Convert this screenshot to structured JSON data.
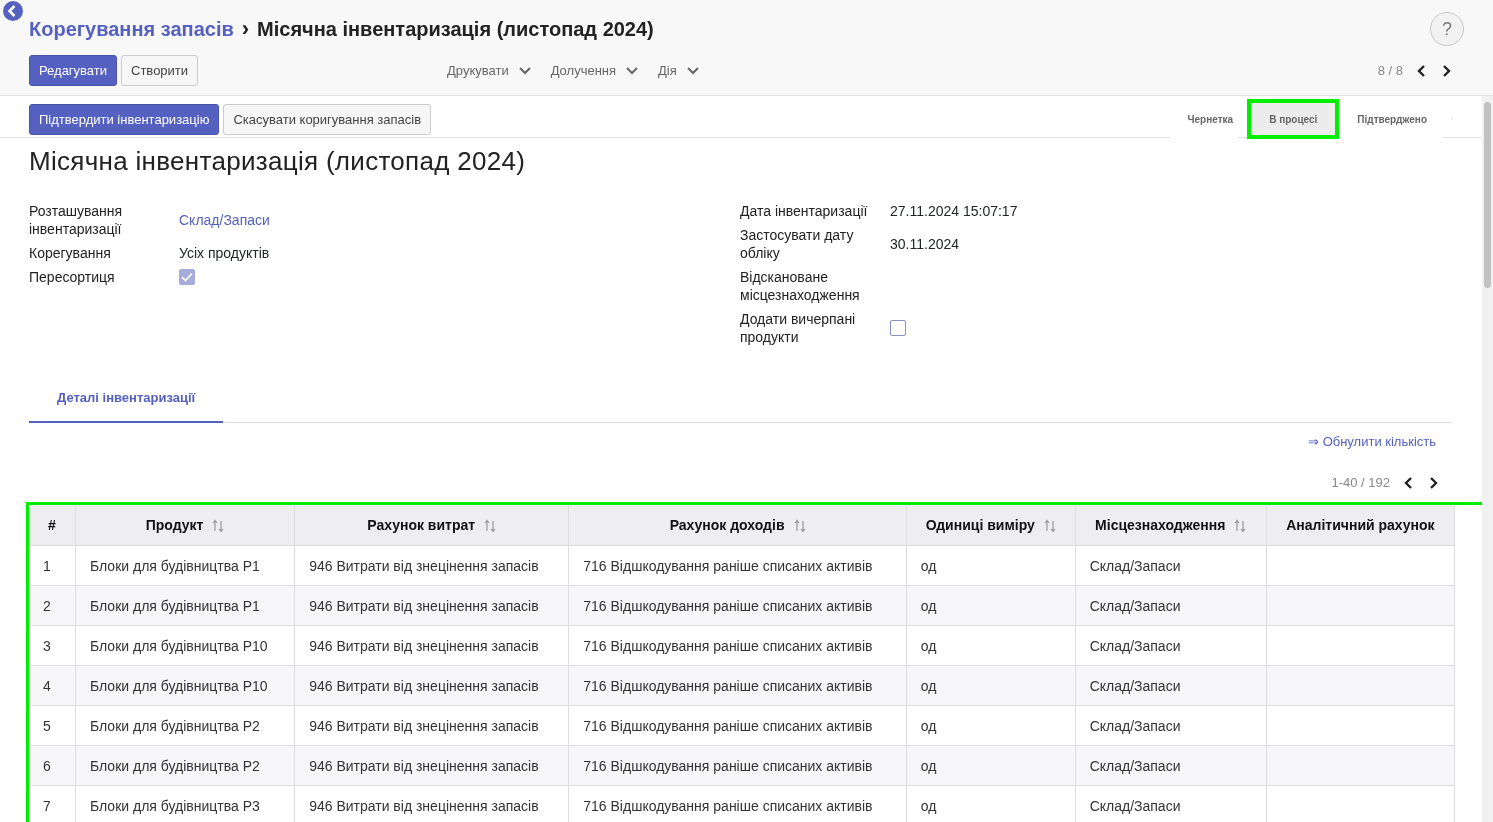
{
  "breadcrumb": {
    "parent": "Корегування запасів",
    "separator": "›",
    "current": "Місячна інвентаризація (листопад 2024)"
  },
  "help": "?",
  "record_buttons": [
    {
      "label": "Редагувати",
      "kind": "primary"
    },
    {
      "label": "Створити",
      "kind": "secondary"
    }
  ],
  "dropdowns": [
    "Друкувати",
    "Долучення",
    "Дія"
  ],
  "pager": "8 / 8",
  "actions": [
    {
      "label": "Підтвердити інвентаризацію",
      "kind": "primary"
    },
    {
      "label": "Скасувати коригування запасів",
      "kind": "secondary"
    }
  ],
  "statusbar": [
    {
      "label": "Чернетка",
      "selected": false
    },
    {
      "label": "В процесі",
      "selected": true
    },
    {
      "label": "Підтверджено",
      "selected": false
    }
  ],
  "title": "Місячна інвентаризація (листопад 2024)",
  "fields_left": [
    {
      "label": "Розташування інвентаризації",
      "kind": "link",
      "value": "Склад/Запаси"
    },
    {
      "label": "Корегування",
      "kind": "text",
      "value": "Усіх продуктів"
    },
    {
      "label": "Пересортиця",
      "kind": "checkbox",
      "checked": true
    }
  ],
  "fields_right": [
    {
      "label": "Дата інвентаризації",
      "kind": "text",
      "value": "27.11.2024 15:07:17"
    },
    {
      "label": "Застосувати дату обліку",
      "kind": "text",
      "value": "30.11.2024"
    },
    {
      "label": "Відскановане місцезнаходження",
      "kind": "text"
    },
    {
      "label": "Додати вичерпані продукти",
      "kind": "checkbox",
      "checked": false
    }
  ],
  "tabs": [
    {
      "label": "Деталі інвентаризації",
      "selected": true
    }
  ],
  "reset_link": "⇒ Обнулити кількість",
  "list_pager": "1-40 / 192",
  "table": {
    "columns": [
      {
        "label": "#",
        "sortable": false
      },
      {
        "label": "Продукт",
        "sortable": true
      },
      {
        "label": "Рахунок витрат",
        "sortable": true
      },
      {
        "label": "Рахунок доходів",
        "sortable": true
      },
      {
        "label": "Одиниці виміру",
        "sortable": true
      },
      {
        "label": "Місцезнаходження",
        "sortable": true
      },
      {
        "label": "Аналітичний рахунок",
        "sortable": false
      }
    ],
    "rows": [
      {
        "cells": [
          "1",
          "Блоки для будівництва P1",
          "946 Витрати від знецінення запасів",
          "716 Відшкодування раніше списаних активів",
          "од",
          "Склад/Запаси"
        ]
      },
      {
        "cells": [
          "2",
          "Блоки для будівництва P1",
          "946 Витрати від знецінення запасів",
          "716 Відшкодування раніше списаних активів",
          "од",
          "Склад/Запаси"
        ]
      },
      {
        "cells": [
          "3",
          "Блоки для будівництва P10",
          "946 Витрати від знецінення запасів",
          "716 Відшкодування раніше списаних активів",
          "од",
          "Склад/Запаси"
        ]
      },
      {
        "cells": [
          "4",
          "Блоки для будівництва P10",
          "946 Витрати від знецінення запасів",
          "716 Відшкодування раніше списаних активів",
          "од",
          "Склад/Запаси"
        ]
      },
      {
        "cells": [
          "5",
          "Блоки для будівництва P2",
          "946 Витрати від знецінення запасів",
          "716 Відшкодування раніше списаних активів",
          "од",
          "Склад/Запаси"
        ]
      },
      {
        "cells": [
          "6",
          "Блоки для будівництва P2",
          "946 Витрати від знецінення запасів",
          "716 Відшкодування раніше списаних активів",
          "од",
          "Склад/Запаси"
        ]
      },
      {
        "cells": [
          "7",
          "Блоки для будівництва P3",
          "946 Витрати від знецінення запасів",
          "716 Відшкодування раніше списаних активів",
          "од",
          "Склад/Запаси"
        ]
      }
    ]
  }
}
